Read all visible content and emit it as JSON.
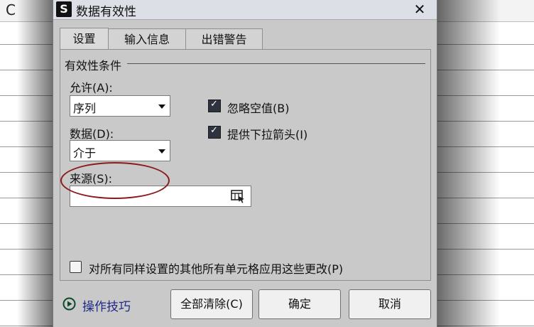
{
  "sheet": {
    "column_letter": "C"
  },
  "dialog": {
    "title": "数据有效性",
    "app_icon_letter": "S",
    "close_glyph": "✕",
    "tabs": [
      {
        "label": "设置",
        "active": true
      },
      {
        "label": "输入信息",
        "active": false
      },
      {
        "label": "出错警告",
        "active": false
      }
    ],
    "group_label": "有效性条件",
    "allow": {
      "label": "允许(A):",
      "value": "序列"
    },
    "data": {
      "label": "数据(D):",
      "value": "介于"
    },
    "ignore_blank": {
      "label": "忽略空值(B)",
      "checked": true
    },
    "dropdown_arrow": {
      "label": "提供下拉箭头(I)",
      "checked": true
    },
    "source": {
      "label": "来源(S):",
      "value": ""
    },
    "apply_all": {
      "label": "对所有同样设置的其他所有单元格应用这些更改(P)",
      "checked": false
    },
    "tips_link": "操作技巧",
    "buttons": {
      "clear_all": "全部清除(C)",
      "ok": "确定",
      "cancel": "取消"
    }
  },
  "colors": {
    "dialog_bg": "#c9c9c9",
    "checkbox_fill": "#2e3340",
    "link": "#1f2a88",
    "annotation": "#8b1a1a"
  }
}
